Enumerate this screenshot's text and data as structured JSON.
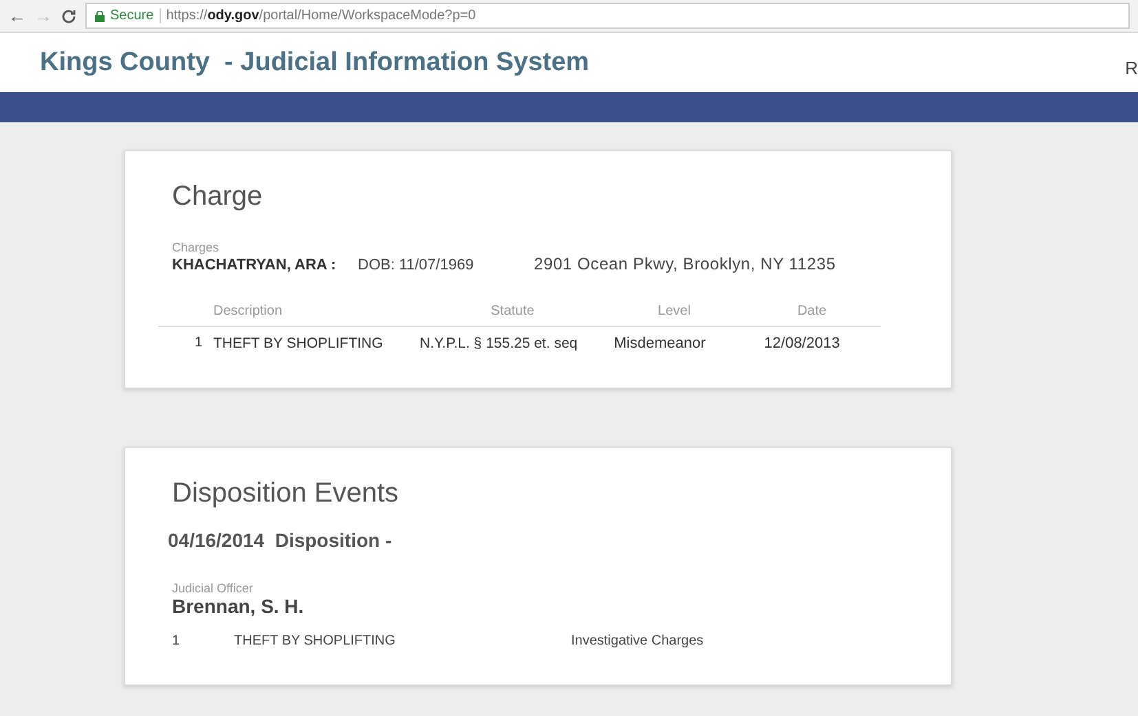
{
  "browser": {
    "back": "←",
    "forward": "→",
    "security": "Secure",
    "url_scheme": "https://",
    "url_host": "ody.gov",
    "url_path": "/portal/Home/WorkspaceMode?p=0"
  },
  "header": {
    "title": "Kings County  - Judicial Information System",
    "right_text": "R"
  },
  "charge_card": {
    "title": "Charge",
    "label": "Charges",
    "party": "KHACHATRYAN, ARA :",
    "dob": "DOB: 11/07/1969",
    "address": "2901 Ocean Pkwy, Brooklyn, NY 11235",
    "columns": [
      "Description",
      "Statute",
      "Level",
      "Date"
    ],
    "rows": [
      {
        "number": "1",
        "description": "THEFT BY SHOPLIFTING",
        "statute": "N.Y.P.L. § 155.25 et. seq",
        "level_text": "Misdemeanor",
        "date": "12/08/2013"
      }
    ]
  },
  "disposition_card": {
    "title": "Disposition Events",
    "event": "04/16/2014  Disposition -",
    "officer_label": "Judicial Officer",
    "officer": "Brennan, S. H.",
    "rows": [
      {
        "number": "1",
        "description": "THEFT BY SHOPLIFTING",
        "outcome": "Investigative Charges"
      }
    ]
  }
}
